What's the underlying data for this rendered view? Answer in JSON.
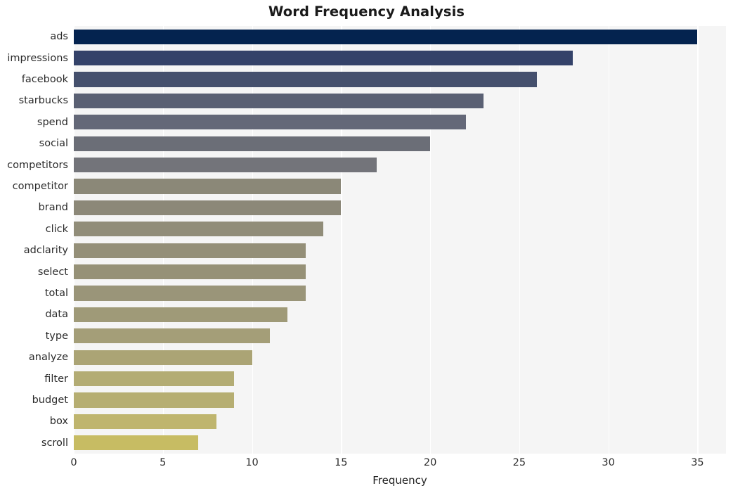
{
  "chart_data": {
    "type": "bar",
    "orientation": "horizontal",
    "title": "Word Frequency Analysis",
    "xlabel": "Frequency",
    "ylabel": "",
    "xlim": [
      0,
      36.6
    ],
    "xticks": [
      0,
      5,
      10,
      15,
      20,
      25,
      30,
      35
    ],
    "xtick_labels": [
      "0",
      "5",
      "10",
      "15",
      "20",
      "25",
      "30",
      "35"
    ],
    "grid": "vertical-only",
    "legend": "none",
    "background": "#f5f5f5",
    "gridline_color": "#ffffff",
    "colormap": "cividis",
    "categories": [
      "ads",
      "impressions",
      "facebook",
      "starbucks",
      "spend",
      "social",
      "competitors",
      "competitor",
      "brand",
      "click",
      "adclarity",
      "select",
      "total",
      "data",
      "type",
      "analyze",
      "filter",
      "budget",
      "box",
      "scroll"
    ],
    "values": [
      35,
      28,
      26,
      23,
      22,
      20,
      17,
      15,
      15,
      14,
      13,
      13,
      13,
      12,
      11,
      10,
      9,
      9,
      8,
      7
    ],
    "bar_colors": [
      "#04234f",
      "#344269",
      "#45506d",
      "#5a6073",
      "#646878",
      "#6b6e77",
      "#73747a",
      "#8b8878",
      "#8c8878",
      "#918d79",
      "#948f78",
      "#969177",
      "#9a9579",
      "#9f9a78",
      "#a49e78",
      "#aba475",
      "#b3ac74",
      "#b6ae72",
      "#bfb56e",
      "#c7bc63"
    ]
  }
}
